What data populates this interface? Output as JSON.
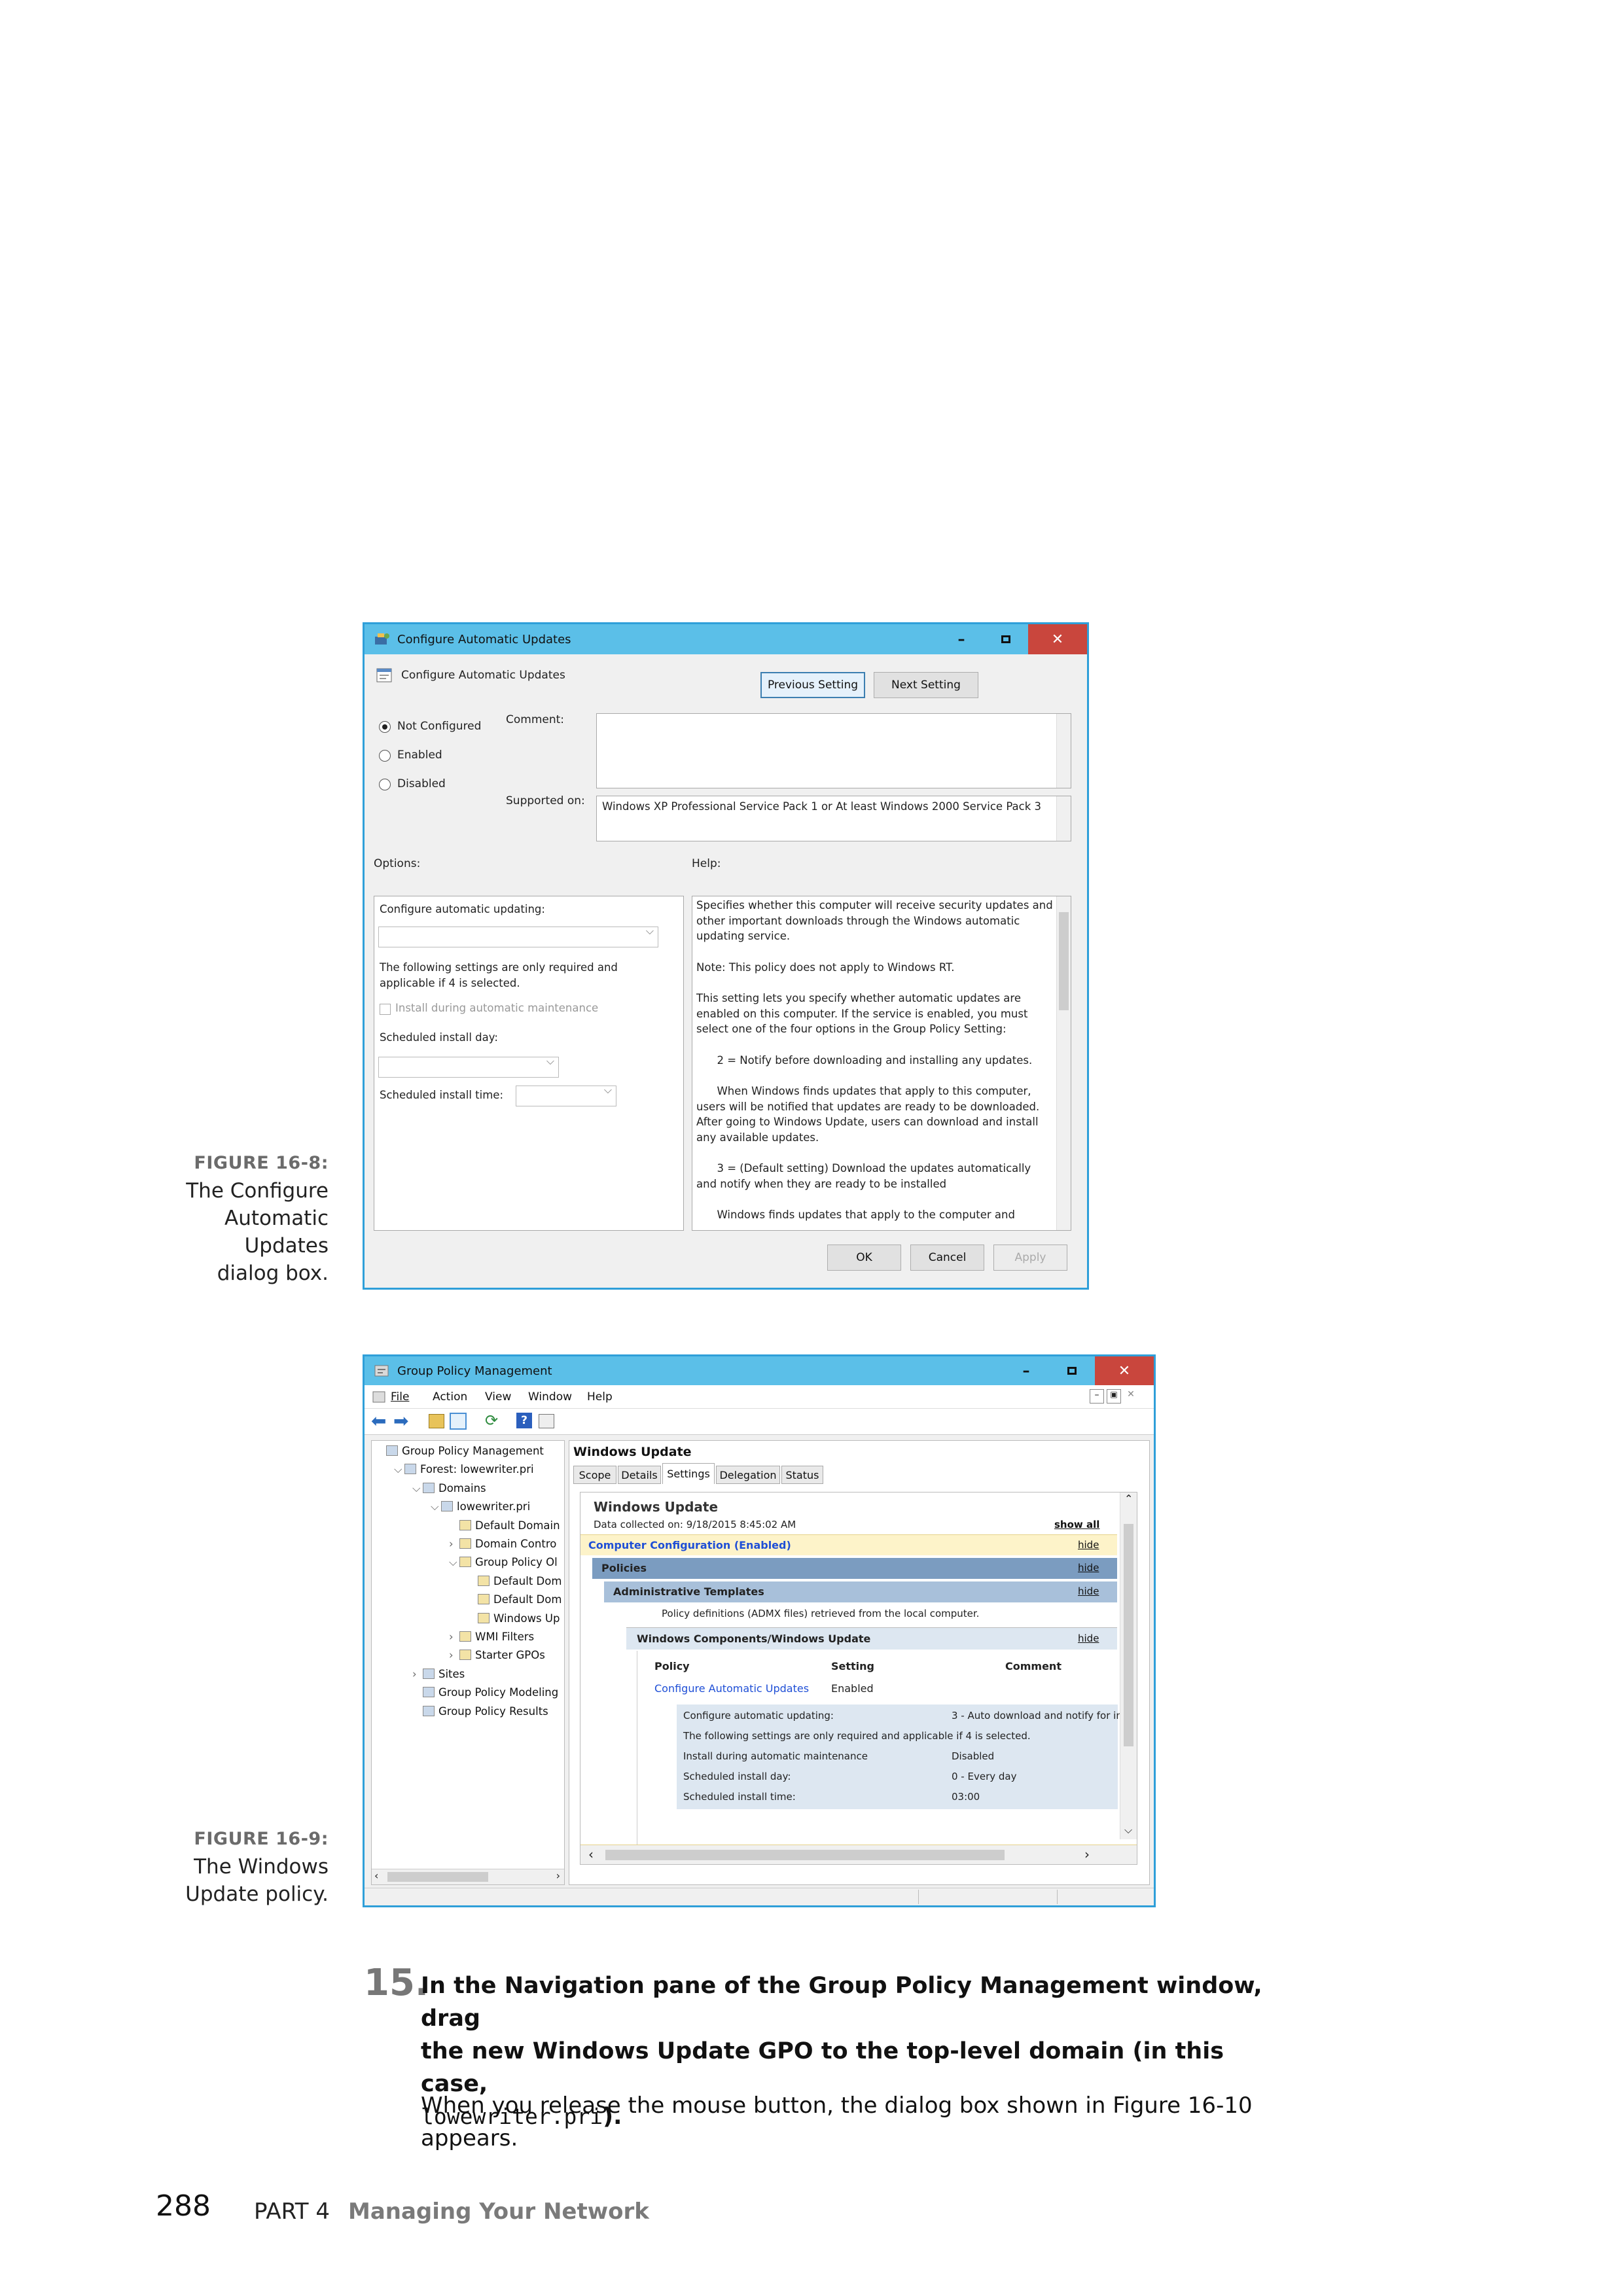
{
  "figure1": {
    "caption_num": "FIGURE 16-8:",
    "caption_lines": [
      "The Configure",
      "Automatic",
      "Updates",
      "dialog box."
    ],
    "window_title": "Configure Automatic Updates",
    "setting_name": "Configure Automatic Updates",
    "prev_button": "Previous Setting",
    "next_button": "Next Setting",
    "radio_not_configured": "Not Configured",
    "radio_enabled": "Enabled",
    "radio_disabled": "Disabled",
    "comment_label": "Comment:",
    "supported_label": "Supported on:",
    "supported_value": "Windows XP Professional Service Pack 1 or At least Windows 2000 Service Pack 3",
    "options_label": "Options:",
    "help_label": "Help:",
    "options": {
      "configure_label": "Configure automatic updating:",
      "note_line1": "The following settings are only required and",
      "note_line2": "applicable if 4 is selected.",
      "install_maintenance": "Install during automatic maintenance",
      "install_day_label": "Scheduled install day:",
      "install_time_label": "Scheduled install time:"
    },
    "help_lines": [
      [
        "Specifies whether this computer will receive security updates and",
        "other important downloads through the Windows automatic",
        "updating service."
      ],
      [
        "Note: This policy does not apply to Windows RT."
      ],
      [
        "This setting lets you specify whether automatic updates are",
        "enabled on this computer. If the service is enabled, you must",
        "select one of the four options in the Group Policy Setting:"
      ],
      [
        "      2 = Notify before downloading and installing any updates."
      ],
      [
        "      When Windows finds updates that apply to this computer,",
        "users will be notified that updates are ready to be downloaded.",
        "After going to Windows Update, users can download and install",
        "any available updates."
      ],
      [
        "      3 = (Default setting) Download the updates automatically",
        "and notify when they are ready to be installed"
      ],
      [
        "      Windows finds updates that apply to the computer and"
      ]
    ],
    "ok": "OK",
    "cancel": "Cancel",
    "apply": "Apply"
  },
  "figure2": {
    "caption_num": "FIGURE 16-9:",
    "caption_lines": [
      "The Windows",
      "Update policy."
    ],
    "window_title": "Group Policy Management",
    "menu": [
      "File",
      "Action",
      "View",
      "Window",
      "Help"
    ],
    "tree": [
      {
        "label": "Group Policy Management",
        "indent": 0,
        "arrow": ""
      },
      {
        "label": "Forest: lowewriter.pri",
        "indent": 1,
        "arrow": "⌵"
      },
      {
        "label": "Domains",
        "indent": 2,
        "arrow": "⌵"
      },
      {
        "label": "lowewriter.pri",
        "indent": 3,
        "arrow": "⌵"
      },
      {
        "label": "Default Domain",
        "indent": 4,
        "arrow": ""
      },
      {
        "label": "Domain Contro",
        "indent": 4,
        "arrow": "›"
      },
      {
        "label": "Group Policy Ol",
        "indent": 4,
        "arrow": "⌵"
      },
      {
        "label": "Default Dom",
        "indent": 5,
        "arrow": ""
      },
      {
        "label": "Default Dom",
        "indent": 5,
        "arrow": ""
      },
      {
        "label": "Windows Up",
        "indent": 5,
        "arrow": ""
      },
      {
        "label": "WMI Filters",
        "indent": 4,
        "arrow": "›"
      },
      {
        "label": "Starter GPOs",
        "indent": 4,
        "arrow": "›"
      },
      {
        "label": "Sites",
        "indent": 2,
        "arrow": "›"
      },
      {
        "label": "Group Policy Modeling",
        "indent": 2,
        "arrow": ""
      },
      {
        "label": "Group Policy Results",
        "indent": 2,
        "arrow": ""
      }
    ],
    "pane_title": "Windows Update",
    "tabs": [
      "Scope",
      "Details",
      "Settings",
      "Delegation",
      "Status"
    ],
    "report_title": "Windows Update",
    "data_collected": "Data collected on: 9/18/2015 8:45:02 AM",
    "show_all": "show all",
    "computer_config": "Computer Configuration (Enabled)",
    "hide": "hide",
    "policies": "Policies",
    "admin_templates": "Administrative Templates",
    "policy_defs": "Policy definitions (ADMX files) retrieved from the local computer.",
    "components": "Windows Components/Windows Update",
    "col_policy": "Policy",
    "col_setting": "Setting",
    "col_comment": "Comment",
    "policy_name": "Configure Automatic Updates",
    "policy_setting": "Enabled",
    "detail_rows": [
      {
        "k": "Configure automatic updating:",
        "v": "3 - Auto download and notify for in"
      },
      {
        "k": "The following settings are only required and applicable if 4 is selected.",
        "v": ""
      },
      {
        "k": "Install during automatic maintenance",
        "v": "Disabled"
      },
      {
        "k": "Scheduled install day:",
        "v": "0 - Every day"
      },
      {
        "k": "Scheduled install time:",
        "v": "03:00"
      }
    ]
  },
  "step": {
    "number": "15.",
    "text_line1": "In the Navigation pane of the Group Policy Management window, drag",
    "text_line2": "the new Windows Update GPO to the top-level domain (in this case,",
    "code": "lowewriter.pri",
    "after_code": ").",
    "para_line1": "When you release the mouse button, the dialog box shown in Figure 16-10",
    "para_line2": "appears."
  },
  "footer": {
    "page": "288",
    "part": "PART 4",
    "part_title": "Managing Your Network"
  },
  "colors": {
    "title_bar": "#5bbfe8",
    "window_border": "#2f9fd9",
    "close_red": "#c9463d",
    "report_header": "#7b9cc0",
    "config_band": "#fdf3c9"
  }
}
